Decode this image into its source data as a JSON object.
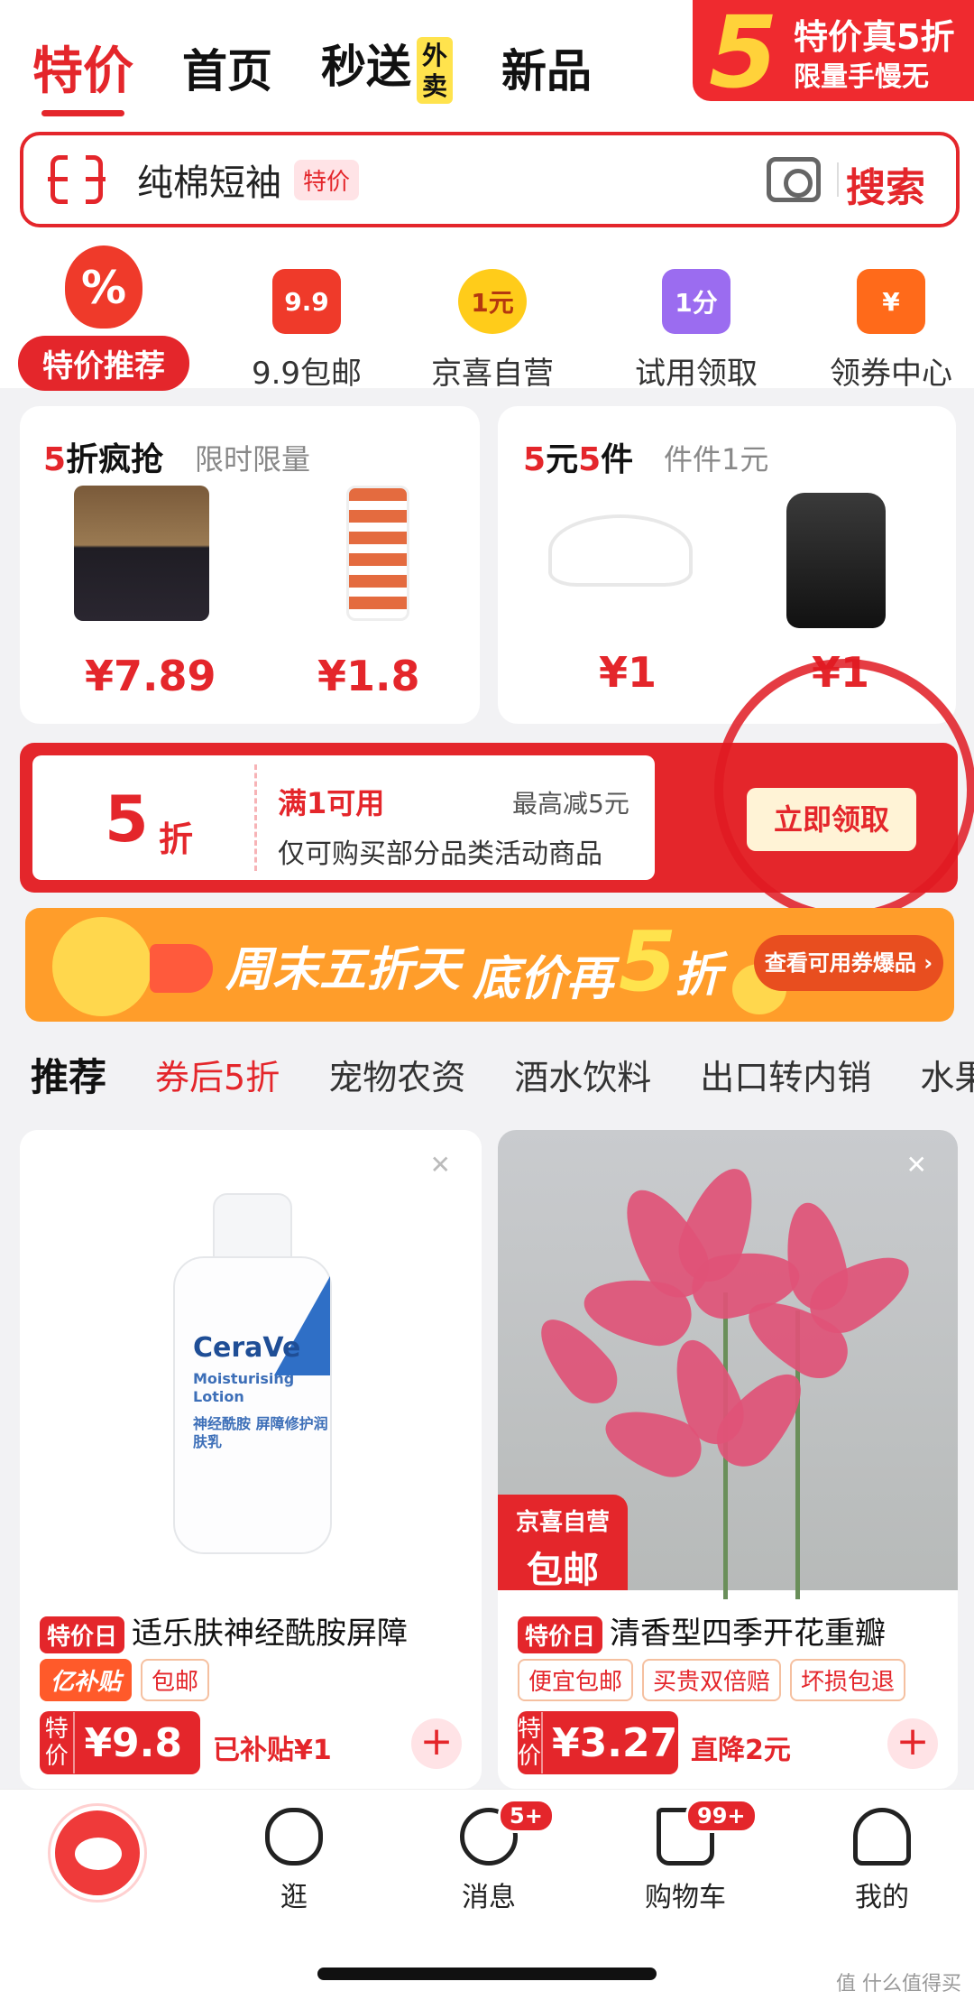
{
  "header": {
    "tabs": [
      {
        "label": "特价",
        "active": true
      },
      {
        "label": "首页"
      },
      {
        "label": "秒送"
      },
      {
        "label": "新品"
      }
    ],
    "waimai_badge": "外卖",
    "corner_promo": {
      "big": "5",
      "line1": "特价真5折",
      "line2": "限量手慢无"
    }
  },
  "search": {
    "value": "纯棉短袖",
    "tag": "特价",
    "button": "搜索"
  },
  "nav": {
    "hot": {
      "icon_text": "%",
      "label": "特价推荐"
    },
    "items": [
      {
        "icon": "9.9-icon",
        "icon_text": "9.9",
        "label": "9.9包邮",
        "color": "#ef3a2a"
      },
      {
        "icon": "jingxi-icon",
        "icon_text": "1元",
        "label": "京喜自营",
        "color": "#ffcc1a"
      },
      {
        "icon": "trial-bag-icon",
        "icon_text": "1分",
        "label": "试用领取",
        "color": "#9b6cf0"
      },
      {
        "icon": "coupon-icon",
        "icon_text": "¥",
        "label": "领券中心",
        "color": "#ff6a1a"
      }
    ]
  },
  "deal_cards": [
    {
      "title_red": "5",
      "title_rest": "折疯抢",
      "subtitle": "限时限量",
      "prices": [
        "¥7.89",
        "¥1.8"
      ]
    },
    {
      "title_red": "5",
      "title_mid": "元",
      "title_red2": "5",
      "title_rest": "件",
      "subtitle": "件件1元",
      "prices": [
        "¥1",
        "¥1"
      ]
    }
  ],
  "coupon": {
    "big": "5",
    "unit": "折",
    "condition": "满1可用",
    "max": "最高减5元",
    "desc": "仅可购买部分品类活动商品",
    "button": "立即领取"
  },
  "banner": {
    "part1": "周末五折天",
    "part2": "底价再",
    "five": "5",
    "part3": "折",
    "button": "查看可用券爆品 ›"
  },
  "categories": [
    "推荐",
    "券后5折",
    "宠物农资",
    "酒水饮料",
    "出口转内销",
    "水果"
  ],
  "products": [
    {
      "tag": "特价日",
      "title": "适乐肤神经酰胺屏障",
      "chips": [
        "亿补贴",
        "包邮"
      ],
      "price_label": "特价",
      "price": "¥9.8",
      "tip": "已补贴¥1",
      "image": {
        "brand": "CeraVe",
        "text": "Moisturising Lotion",
        "cn": "神经酰胺 屏障修护润肤乳"
      }
    },
    {
      "tag": "特价日",
      "title": "清香型四季开花重瓣",
      "chips": [
        "便宜包邮",
        "买贵双倍赔",
        "坏损包退"
      ],
      "price_label": "特价",
      "price": "¥3.27",
      "tip": "直降2元",
      "badge1": "京喜自营",
      "badge2": "包邮"
    }
  ],
  "tabbar": [
    {
      "label": "",
      "icon": "home-mascot-icon"
    },
    {
      "label": "逛",
      "icon": "stroll-icon"
    },
    {
      "label": "消息",
      "icon": "message-icon",
      "badge": "5+"
    },
    {
      "label": "购物车",
      "icon": "cart-icon",
      "badge": "99+"
    },
    {
      "label": "我的",
      "icon": "profile-icon"
    }
  ],
  "watermark": "值 什么值得买"
}
